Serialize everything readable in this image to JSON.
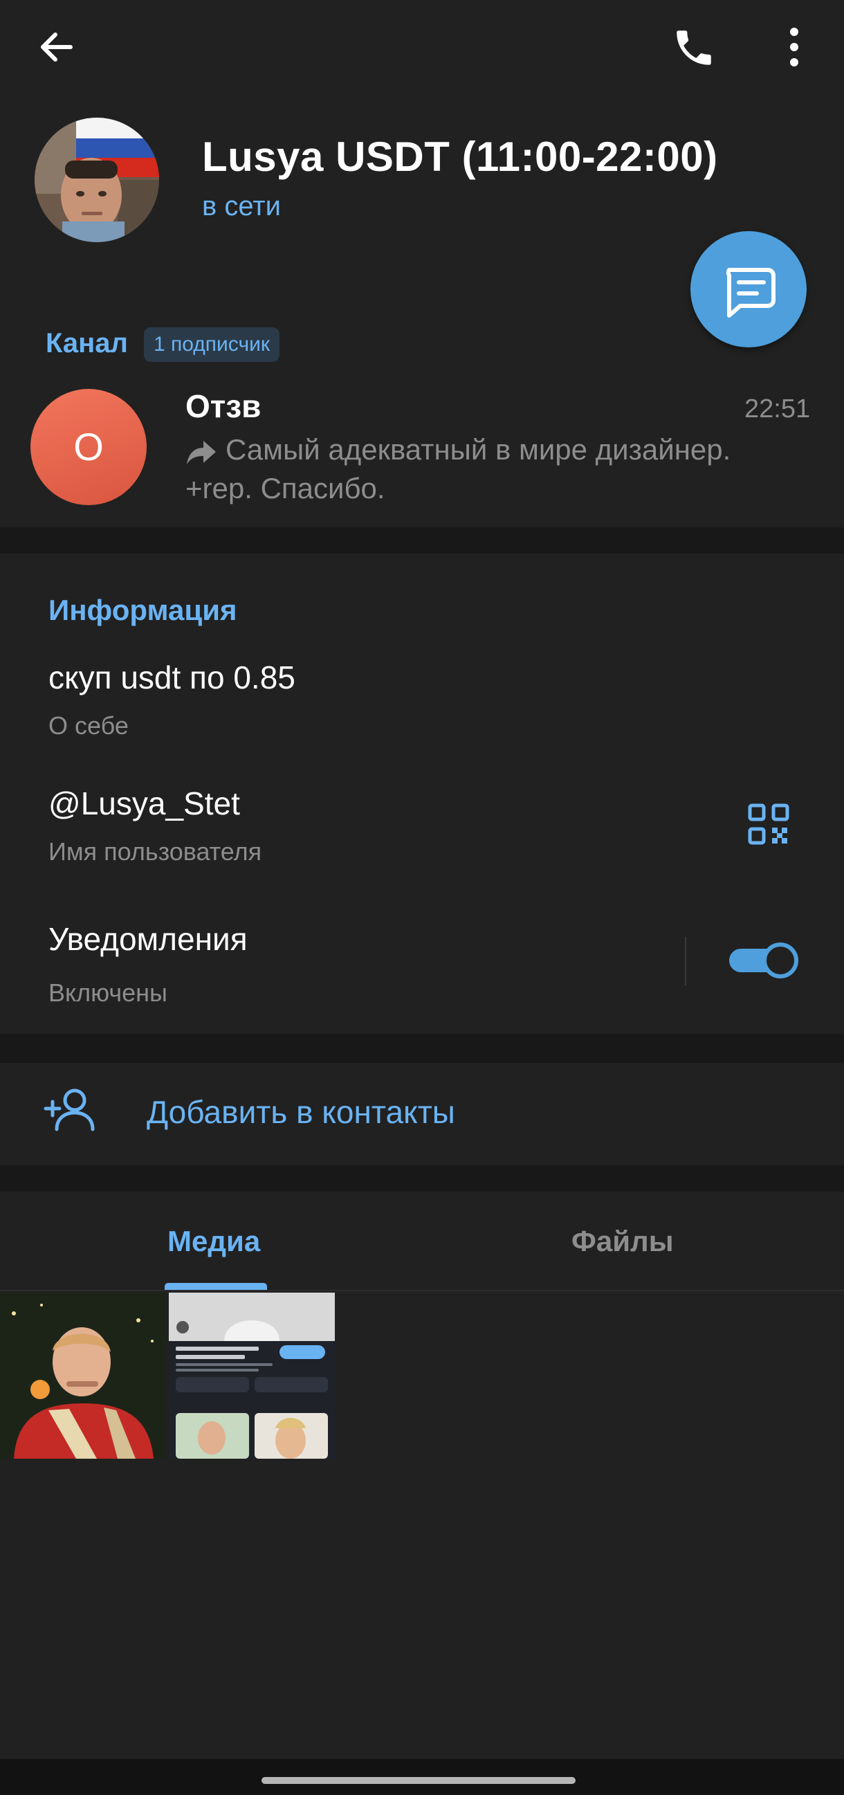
{
  "header": {
    "back_icon": "arrow-left-icon",
    "call_icon": "phone-icon",
    "menu_icon": "more-vertical-icon",
    "title": "Lusya USDT (11:00-22:00)",
    "status": "в сети",
    "fab_icon": "message-icon"
  },
  "channel": {
    "label": "Канал",
    "subscribers": "1 подписчик",
    "avatar_letter": "О",
    "name": "Отзв",
    "time": "22:51",
    "message": "Самый адекватный в мире дизайнер. +rep. Спасибо."
  },
  "info": {
    "title": "Информация",
    "bio_value": "скуп usdt по 0.85",
    "bio_label": "О себе",
    "username_value": "@Lusya_Stet",
    "username_label": "Имя пользователя",
    "notifications_label": "Уведомления",
    "notifications_status": "Включены",
    "notifications_enabled": true
  },
  "add_contact": {
    "label": "Добавить в контакты"
  },
  "media": {
    "tabs": [
      {
        "label": "Медиа",
        "active": true
      },
      {
        "label": "Файлы",
        "active": false
      }
    ]
  },
  "colors": {
    "accent": "#6ab3f3",
    "fab": "#4e9fdc",
    "channel_avatar": "#e8644b"
  }
}
